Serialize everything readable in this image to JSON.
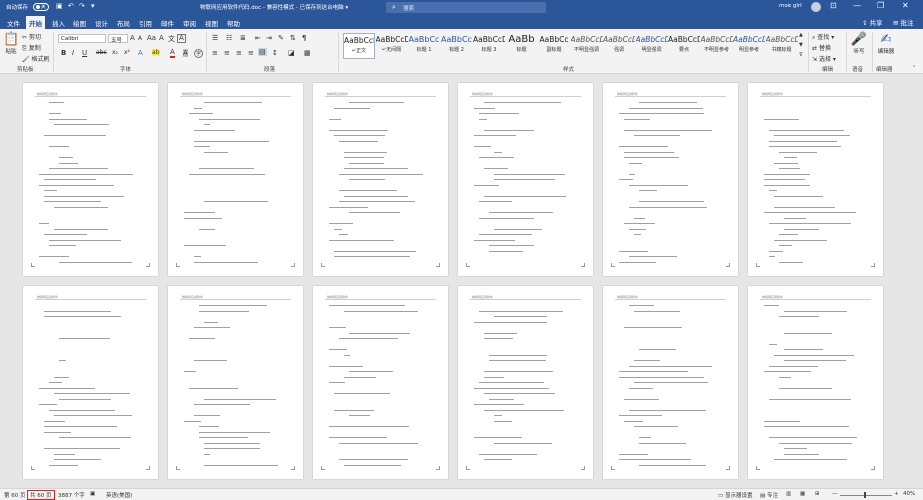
{
  "titlebar": {
    "autosave_label": "自动保存",
    "autosave_state": "关",
    "doc_title": "物联网应用软件代码.doc - 兼容性模式 - 已保存到这台电脑 ▾",
    "search_placeholder": "搜索",
    "user_name": "moe girl",
    "minimize": "—",
    "restore": "❐",
    "close": "✕",
    "ribbon_display": "⊡"
  },
  "quick_access": {
    "save": "▣",
    "undo": "↶",
    "redo": "↷",
    "more": "▾"
  },
  "tabs": [
    "文件",
    "开始",
    "插入",
    "绘图",
    "设计",
    "布局",
    "引用",
    "邮件",
    "审阅",
    "视图",
    "帮助"
  ],
  "active_tab": "开始",
  "share_label": "共享",
  "comment_label": "批注",
  "ribbon": {
    "clipboard": {
      "paste": "粘贴",
      "cut": "剪切",
      "copy": "复制",
      "format_painter": "格式刷",
      "group": "剪贴板"
    },
    "font": {
      "font_name": "Calibri",
      "font_size": "五号",
      "group": "字体",
      "grow": "A",
      "shrink": "A",
      "case": "Aa",
      "clear": "A",
      "phonetic": "文",
      "border_char": "A",
      "bold": "B",
      "italic": "I",
      "underline": "U",
      "strike": "abc",
      "sub": "x₂",
      "sup": "x²",
      "effects": "A",
      "highlight": "ab",
      "color": "A",
      "shade": "A",
      "enclose": "字"
    },
    "paragraph": {
      "group": "段落"
    },
    "styles": {
      "group": "样式",
      "items": [
        {
          "sample": "AaBbCcDd",
          "name": "↵正文"
        },
        {
          "sample": "AaBbCcDd",
          "name": "↵无间隔"
        },
        {
          "sample": "AaBbCc",
          "name": "标题 1"
        },
        {
          "sample": "AaBbCc",
          "name": "标题 2"
        },
        {
          "sample": "AaBbCcDc",
          "name": "标题 3"
        },
        {
          "sample": "AaBb",
          "name": "标题"
        },
        {
          "sample": "AaBbCc",
          "name": "副标题"
        },
        {
          "sample": "AaBbCcDc",
          "name": "不明显强调"
        },
        {
          "sample": "AaBbCcDc",
          "name": "强调"
        },
        {
          "sample": "AaBbCcDc",
          "name": "明显强调"
        },
        {
          "sample": "AaBbCcDc",
          "name": "要点"
        },
        {
          "sample": "AaBbCcDc",
          "name": "不明显参考"
        },
        {
          "sample": "AaBbCcDc",
          "name": "明显参考"
        },
        {
          "sample": "AaBbCcDc",
          "name": "书籍标题"
        }
      ]
    },
    "editing": {
      "find": "查找",
      "replace": "替换",
      "select": "选择",
      "group": "编辑"
    },
    "voice": {
      "dictate": "听写",
      "group": "语音"
    },
    "editor": {
      "label": "编辑器",
      "group": "编辑器"
    }
  },
  "pages": [
    {
      "header": "物联网应用软件"
    },
    {
      "header": "物联网应用软件"
    },
    {
      "header": "物联网应用软件"
    },
    {
      "header": "物联网应用软件"
    },
    {
      "header": "物联网应用软件"
    },
    {
      "header": "物联网应用软件"
    },
    {
      "header": "物联网应用软件"
    },
    {
      "header": "物联网应用软件"
    },
    {
      "header": "物联网应用软件"
    },
    {
      "header": "物联网应用软件"
    },
    {
      "header": "物联网应用软件"
    },
    {
      "header": "物联网应用软件"
    }
  ],
  "status": {
    "page_info": "第 60 页",
    "page_total": "共 60 页",
    "word_count": "3887 个字",
    "language": "英语(美国)",
    "display_settings": "显示器设置",
    "focus": "专注",
    "zoom_minus": "—",
    "zoom_plus": "+",
    "zoom": "40%"
  },
  "colors": {
    "accent": "#2b579a",
    "page_box": "#e02020"
  }
}
